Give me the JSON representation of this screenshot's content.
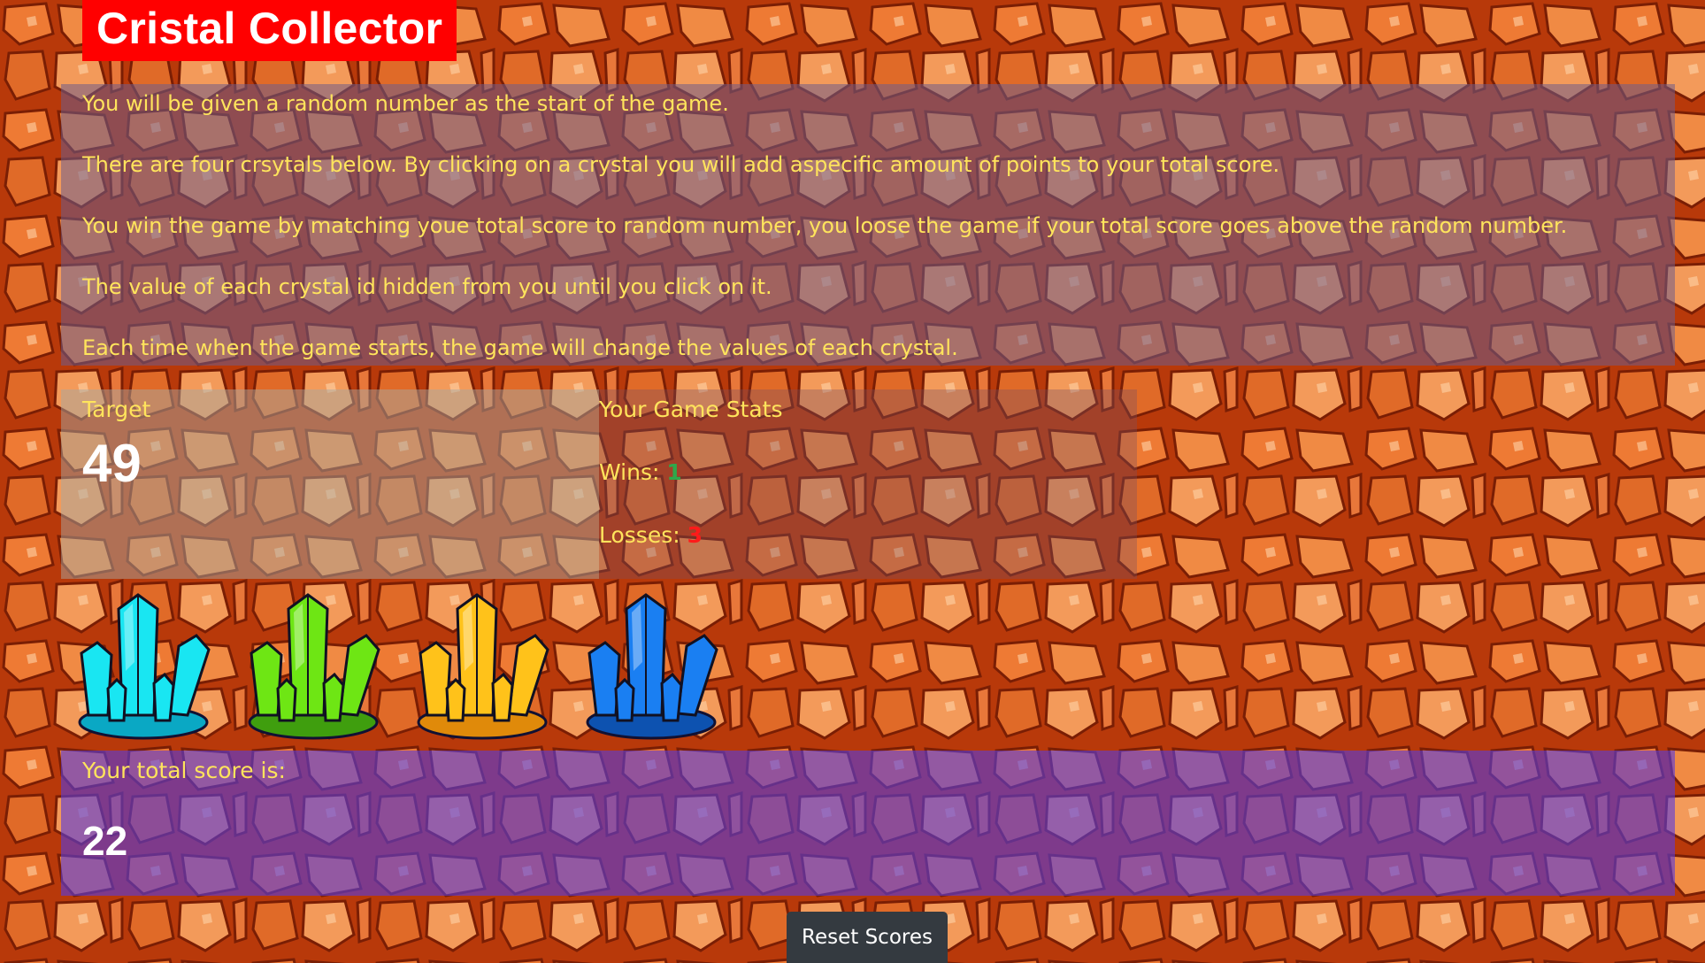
{
  "app": {
    "title": "Cristal Collector"
  },
  "instructions": [
    "You will be given a random number as the start of the game.",
    "There are four crsytals below. By clicking on a crystal you will add aspecific amount of points to your total score.",
    "You win the game by matching youe total score to random number, you loose the game if your total score goes above the random number.",
    "The value of each crystal id hidden from you until you click on it.",
    "Each time when the game starts, the game will change the values of each crystal."
  ],
  "target": {
    "label": "Target",
    "value": "49"
  },
  "stats": {
    "heading": "Your Game Stats",
    "wins_label": "Wins: ",
    "wins_value": "1",
    "losses_label": "Losses: ",
    "losses_value": "3"
  },
  "crystals": [
    {
      "name": "cyan-crystal-icon",
      "color": "#19e6f2",
      "dark": "#0aa8c4"
    },
    {
      "name": "green-crystal-icon",
      "color": "#6ee614",
      "dark": "#3f9e0e"
    },
    {
      "name": "yellow-crystal-icon",
      "color": "#ffc21a",
      "dark": "#e08a0a"
    },
    {
      "name": "blue-crystal-icon",
      "color": "#1a7ff2",
      "dark": "#0d52b0"
    }
  ],
  "score": {
    "label": "Your total score is:",
    "value": "22"
  },
  "reset": {
    "label": "Reset Scores"
  },
  "colors": {
    "title_bg": "#ff0000",
    "text_yellow": "#ffe45c",
    "wins_green": "#2ea84a",
    "losses_red": "#ff1a1a",
    "score_panel": "#5a3cdc",
    "button_dark": "#343a40"
  }
}
